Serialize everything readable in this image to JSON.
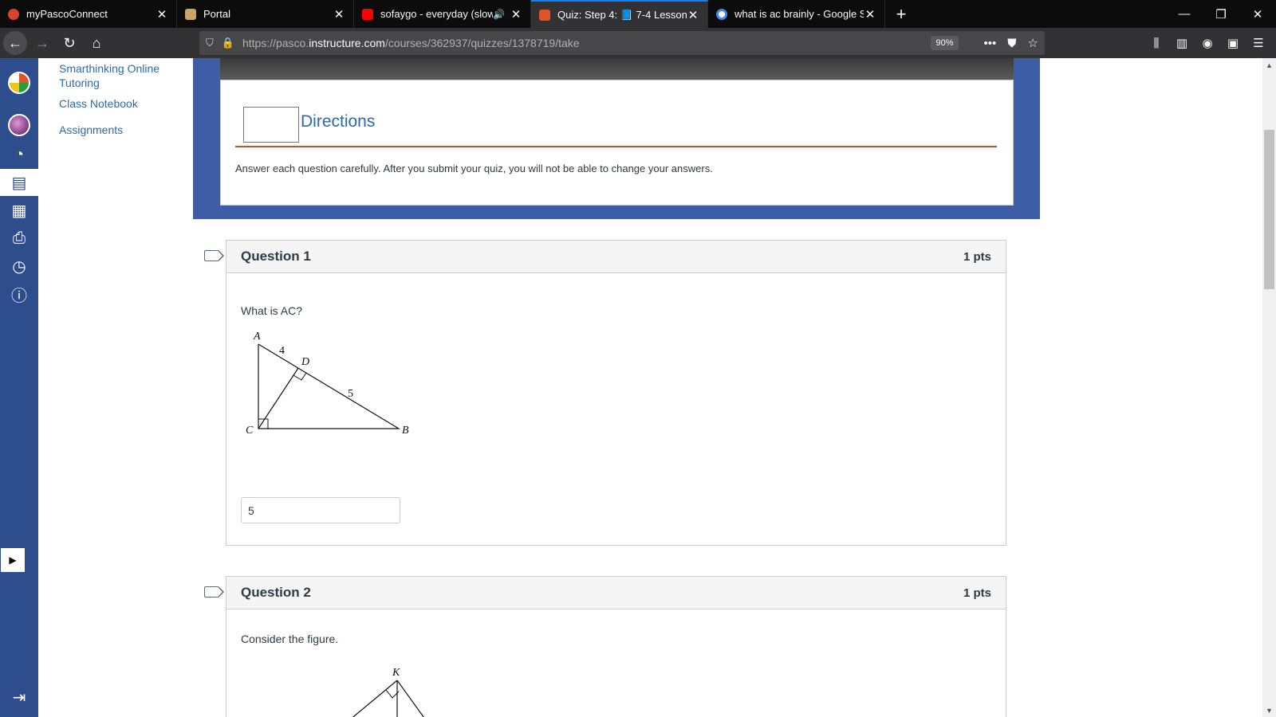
{
  "browser": {
    "tabs": [
      {
        "title": "myPascoConnect",
        "favicon_color": "#d9442c"
      },
      {
        "title": "Portal",
        "favicon_color": "#c9a46b"
      },
      {
        "title": "sofaygo - everyday (slowed",
        "favicon_color": "#ff0000",
        "audio": true
      },
      {
        "title": "Quiz: Step 4: 📘 7-4 Lesson Quiz",
        "favicon_color": "#e0542a",
        "active": true
      },
      {
        "title": "what is ac brainly - Google Sear",
        "favicon_color": "#4285f4"
      }
    ],
    "new_tab_label": "+",
    "url": {
      "prefix": "https://pasco.",
      "host": "instructure.com",
      "path": "/courses/362937/quizzes/1378719/take"
    },
    "zoom": "90%"
  },
  "course_nav": {
    "items": [
      "Smarthinking Online Tutoring",
      "Class Notebook",
      "Assignments"
    ]
  },
  "directions": {
    "title": "Directions",
    "text": "Answer each question carefully. After you submit your quiz, you will not be able to change your answers."
  },
  "questions": [
    {
      "name": "Question 1",
      "points": "1 pts",
      "text": "What is AC?",
      "answer": "5",
      "figure_labels": {
        "a": "A",
        "b": "B",
        "c": "C",
        "d": "D",
        "ad": "4",
        "db": "5"
      }
    },
    {
      "name": "Question 2",
      "points": "1 pts",
      "text": "Consider the figure.",
      "figure_labels": {
        "k": "K"
      }
    }
  ],
  "colors": {
    "rail": "#2d4d8c",
    "banner": "#3d5da6",
    "link": "#2d6aa8",
    "directions_rule": "#c8532a",
    "tab_highlight": "#0a84ff"
  }
}
